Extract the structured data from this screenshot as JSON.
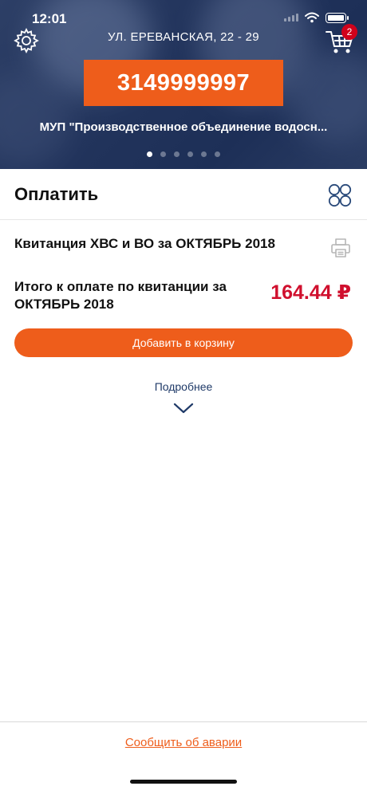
{
  "status_bar": {
    "time": "12:01"
  },
  "header": {
    "address": "УЛ. ЕРЕВАНСКАЯ, 22 - 29",
    "account_number": "3149999997",
    "organization": "МУП \"Производственное объединение водосн...",
    "cart_count": "2",
    "carousel": {
      "total": 6,
      "active_index": 0
    },
    "icons": {
      "settings": "gear-icon",
      "cart": "cart-icon"
    }
  },
  "payment": {
    "section_title": "Оплатить",
    "receipt_title": "Квитанция ХВС и ВО за ОКТЯБРЬ 2018",
    "total_label": "Итого к оплате по квитанции за ОКТЯБРЬ 2018",
    "total_amount": "164.44 ₽",
    "add_to_cart_label": "Добавить в корзину",
    "more_label": "Подробнее",
    "icons": {
      "grid": "grid-view-icon",
      "print": "printer-icon",
      "expand": "chevron-down-icon"
    }
  },
  "footer": {
    "report_label": "Сообщить об аварии"
  },
  "colors": {
    "accent": "#ee5d1b",
    "header_bg": "#22345c",
    "amount": "#d0102e",
    "link": "#1f3a68",
    "badge": "#d0021b"
  }
}
